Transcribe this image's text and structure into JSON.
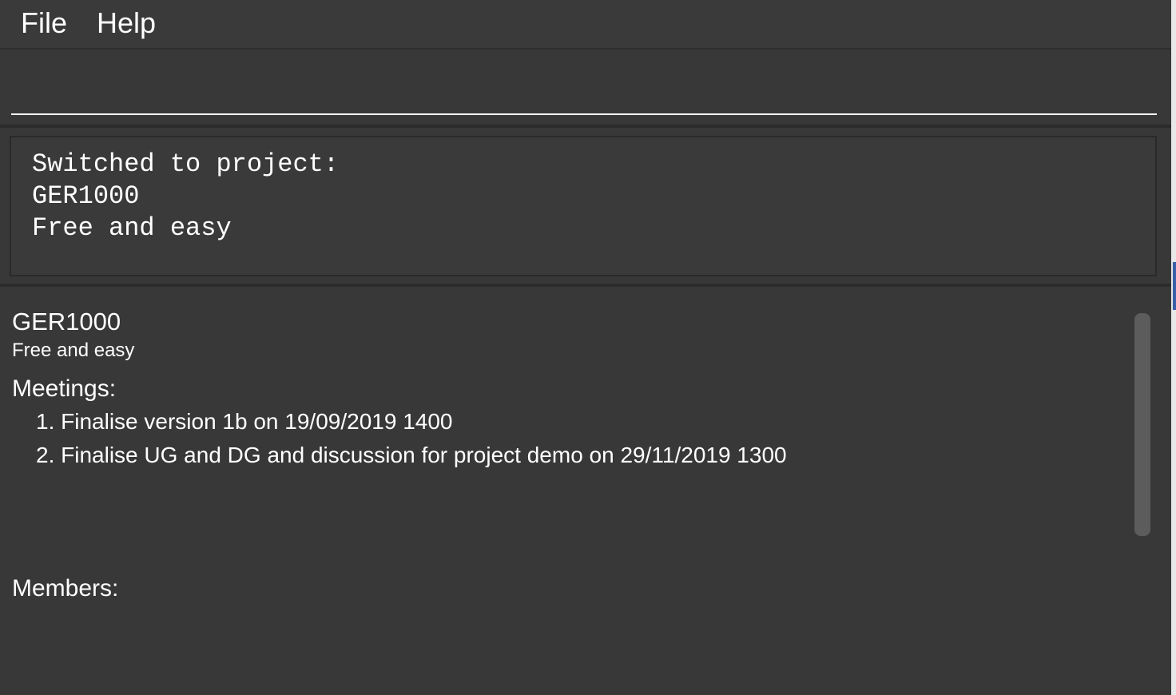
{
  "menubar": {
    "items": [
      {
        "label": "File"
      },
      {
        "label": "Help"
      }
    ]
  },
  "command": {
    "value": "",
    "placeholder": ""
  },
  "result": {
    "text": "Switched to project:\nGER1000\nFree and easy"
  },
  "project": {
    "name": "GER1000",
    "description": "Free and easy",
    "meetings_label": "Meetings:",
    "meetings": [
      "1. Finalise version 1b on 19/09/2019 1400",
      "2. Finalise UG and DG and discussion for project demo on 29/11/2019 1300"
    ],
    "members_label": "Members:"
  },
  "colors": {
    "background": "#383838",
    "text": "#ffffff",
    "scrollbar": "#5c5c5c"
  }
}
